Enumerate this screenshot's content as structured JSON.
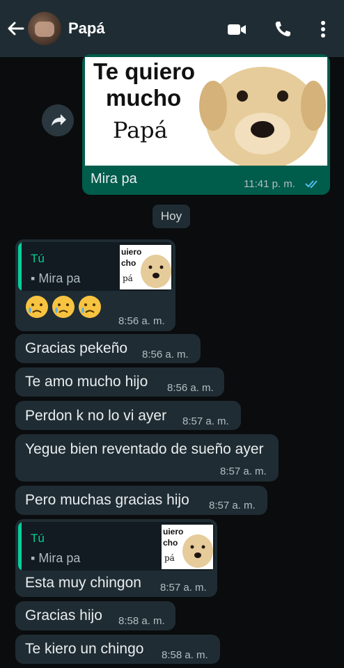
{
  "header": {
    "contact_name": "Papá"
  },
  "sticker_message": {
    "line1": "Te quiero",
    "line2": "mucho",
    "line3": "Papá",
    "caption": "Mira pa",
    "time": "11:41 p. m."
  },
  "date_divider": "Hoy",
  "messages": [
    {
      "text": "",
      "time": "8:56 a. m.",
      "reply": {
        "author": "Tú",
        "text": "Mira pa",
        "thumb_lines": [
          "uiero",
          "cho",
          "pá"
        ]
      }
    },
    {
      "text": "Gracias pekeño",
      "time": "8:56 a. m."
    },
    {
      "text": "Te amo mucho hijo",
      "time": "8:56 a. m."
    },
    {
      "text": "Perdon k no lo vi ayer",
      "time": "8:57 a. m."
    },
    {
      "text": "Yegue bien reventado de sueño ayer",
      "time": "8:57 a. m."
    },
    {
      "text": "Pero muchas gracias hijo",
      "time": "8:57 a. m."
    },
    {
      "text": "Esta muy chingon",
      "time": "8:57 a. m.",
      "reply": {
        "author": "Tú",
        "text": "Mira pa",
        "thumb_lines": [
          "uiero",
          "cho",
          "pá"
        ]
      }
    },
    {
      "text": "Gracias hijo",
      "time": "8:58 a. m."
    },
    {
      "text": "Te kiero un chingo",
      "time": "8:58 a. m."
    }
  ],
  "colors": {
    "accent": "#06cf9c",
    "outgoing": "#005c4b",
    "incoming": "#1f2c33",
    "header": "#1f2c33"
  }
}
